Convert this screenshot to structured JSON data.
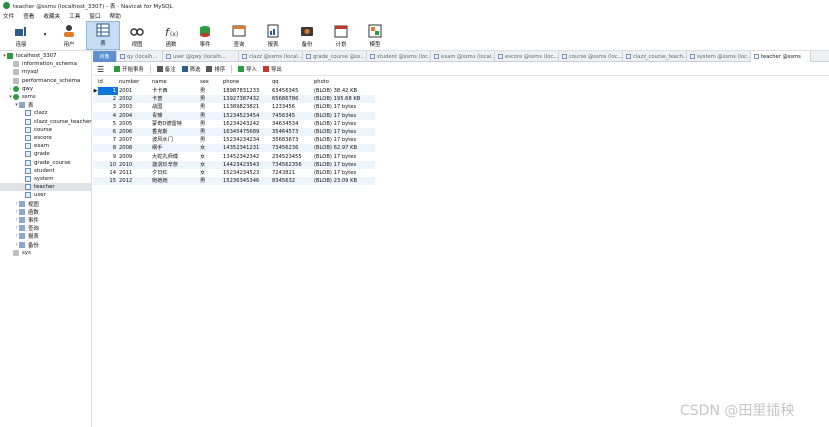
{
  "window": {
    "title": "teacher @ssms (localhost_3307) - 表 - Navicat for MySQL"
  },
  "menu": [
    "文件",
    "查看",
    "收藏夹",
    "工具",
    "窗口",
    "帮助"
  ],
  "toolbar": [
    {
      "name": "connect",
      "label": "连接"
    },
    {
      "name": "user",
      "label": "用户"
    },
    {
      "name": "table",
      "label": "表"
    },
    {
      "name": "view",
      "label": "视图"
    },
    {
      "name": "function",
      "label": "函数"
    },
    {
      "name": "event",
      "label": "事件"
    },
    {
      "name": "query",
      "label": "查询"
    },
    {
      "name": "report",
      "label": "报表"
    },
    {
      "name": "backup",
      "label": "备份"
    },
    {
      "name": "schedule",
      "label": "计划"
    },
    {
      "name": "model",
      "label": "模型"
    }
  ],
  "tree": [
    {
      "label": "localhost_3307",
      "level": 0,
      "icon": "conn",
      "arrow": "▾"
    },
    {
      "label": "information_schema",
      "level": 1,
      "icon": "db",
      "arrow": ""
    },
    {
      "label": "mysql",
      "level": 1,
      "icon": "db",
      "arrow": ""
    },
    {
      "label": "performance_schema",
      "level": 1,
      "icon": "db",
      "arrow": ""
    },
    {
      "label": "qwy",
      "level": 1,
      "icon": "db-green",
      "arrow": "›"
    },
    {
      "label": "ssms",
      "level": 1,
      "icon": "db-green",
      "arrow": "▾"
    },
    {
      "label": "表",
      "level": 2,
      "icon": "folder",
      "arrow": "▾"
    },
    {
      "label": "clazz",
      "level": 3,
      "icon": "table",
      "arrow": ""
    },
    {
      "label": "clazz_course_teacher",
      "level": 3,
      "icon": "table",
      "arrow": ""
    },
    {
      "label": "course",
      "level": 3,
      "icon": "table",
      "arrow": ""
    },
    {
      "label": "escore",
      "level": 3,
      "icon": "table",
      "arrow": ""
    },
    {
      "label": "exam",
      "level": 3,
      "icon": "table",
      "arrow": ""
    },
    {
      "label": "grade",
      "level": 3,
      "icon": "table",
      "arrow": ""
    },
    {
      "label": "grade_course",
      "level": 3,
      "icon": "table",
      "arrow": ""
    },
    {
      "label": "student",
      "level": 3,
      "icon": "table",
      "arrow": ""
    },
    {
      "label": "system",
      "level": 3,
      "icon": "table",
      "arrow": ""
    },
    {
      "label": "teacher",
      "level": 3,
      "icon": "table",
      "arrow": "",
      "selected": true
    },
    {
      "label": "user",
      "level": 3,
      "icon": "table",
      "arrow": ""
    },
    {
      "label": "视图",
      "level": 2,
      "icon": "folder",
      "arrow": "›"
    },
    {
      "label": "函数",
      "level": 2,
      "icon": "folder",
      "arrow": "›"
    },
    {
      "label": "事件",
      "level": 2,
      "icon": "folder",
      "arrow": "›"
    },
    {
      "label": "查询",
      "level": 2,
      "icon": "folder",
      "arrow": "›"
    },
    {
      "label": "报表",
      "level": 2,
      "icon": "folder",
      "arrow": "›"
    },
    {
      "label": "备份",
      "level": 2,
      "icon": "folder",
      "arrow": "›"
    },
    {
      "label": "sys",
      "level": 1,
      "icon": "db",
      "arrow": ""
    }
  ],
  "tabs": [
    {
      "label": "对象",
      "kind": "obj"
    },
    {
      "label": "qy (localh...",
      "kind": ""
    },
    {
      "label": "user @qwy (localh...",
      "kind": ""
    },
    {
      "label": "clazz @ssms (local...",
      "kind": ""
    },
    {
      "label": "grade_course @ss...",
      "kind": ""
    },
    {
      "label": "student @ssms (loc...",
      "kind": ""
    },
    {
      "label": "exam @ssms (local...",
      "kind": ""
    },
    {
      "label": "escore @ssms (loc...",
      "kind": ""
    },
    {
      "label": "course @ssms (loc...",
      "kind": ""
    },
    {
      "label": "clazz_course_teach...",
      "kind": ""
    },
    {
      "label": "system @ssms (loc...",
      "kind": ""
    },
    {
      "label": "teacher @ssms",
      "kind": "active"
    }
  ],
  "subtoolbar": [
    {
      "name": "begin-transaction",
      "label": "开始事务"
    },
    {
      "name": "note",
      "label": "备注"
    },
    {
      "name": "filter",
      "label": "筛选"
    },
    {
      "name": "sort",
      "label": "排序"
    },
    {
      "name": "import",
      "label": "导入"
    },
    {
      "name": "export",
      "label": "导出"
    }
  ],
  "columns": [
    "id",
    "number",
    "name",
    "sex",
    "phone",
    "qq",
    "photo"
  ],
  "rows": [
    [
      "1",
      "2001",
      "卡卡西",
      "男",
      "18987831233",
      "63456345",
      "(BLOB) 38.42 KB"
    ],
    [
      "2",
      "2002",
      "卡普",
      "男",
      "13927387432",
      "65686786",
      "(BLOB) 195.68 KB"
    ],
    [
      "3",
      "2003",
      "战国",
      "男",
      "11389823821",
      "1233456",
      "(BLOB) 17 bytes"
    ],
    [
      "4",
      "2004",
      "青雉",
      "男",
      "15234523454",
      "7456345",
      "(BLOB) 17 bytes"
    ],
    [
      "5",
      "2005",
      "蒙奇D德雷特",
      "男",
      "16234243242",
      "34634534",
      "(BLOB) 17 bytes"
    ],
    [
      "6",
      "2006",
      "香克斯",
      "男",
      "16345475689",
      "35464573",
      "(BLOB) 17 bytes"
    ],
    [
      "7",
      "2007",
      "波风水门",
      "男",
      "15234234234",
      "35683673",
      "(BLOB) 17 bytes"
    ],
    [
      "8",
      "2008",
      "纲手",
      "女",
      "14352341231",
      "73456236",
      "(BLOB) 62.97 KB"
    ],
    [
      "9",
      "2009",
      "大蛇丸师傅",
      "女",
      "13452342342",
      "234523455",
      "(BLOB) 17 bytes"
    ],
    [
      "10",
      "2010",
      "漩涡玖辛奈",
      "女",
      "14423423543",
      "734562356",
      "(BLOB) 17 bytes"
    ],
    [
      "14",
      "2011",
      "夕日红",
      "女",
      "15234234523",
      "7243821",
      "(BLOB) 17 bytes"
    ],
    [
      "15",
      "2012",
      "她她她",
      "男",
      "15236345346",
      "8345632",
      "(BLOB) 23.09 KB"
    ]
  ],
  "watermark": "CSDN @田里插秧"
}
